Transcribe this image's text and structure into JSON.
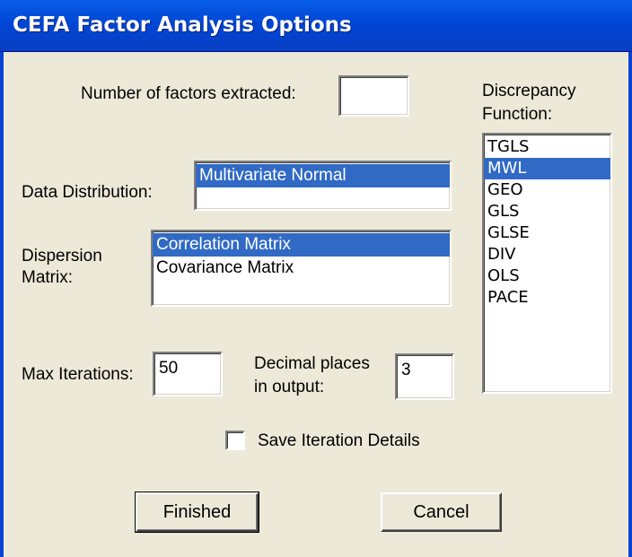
{
  "window": {
    "title": "CEFA Factor Analysis Options"
  },
  "factors": {
    "label": "Number of factors extracted:",
    "value": ""
  },
  "discrepancy": {
    "label_line1": "Discrepancy",
    "label_line2": "Function:",
    "items": [
      "TGLS",
      "MWL",
      "GEO",
      "GLS",
      "GLSE",
      "DIV",
      "OLS",
      "PACE"
    ],
    "selected": "MWL"
  },
  "data_distribution": {
    "label": "Data Distribution:",
    "items": [
      "Multivariate Normal"
    ],
    "selected": "Multivariate Normal"
  },
  "dispersion": {
    "label_line1": "Dispersion",
    "label_line2": "Matrix:",
    "items": [
      "Correlation Matrix",
      "Covariance Matrix"
    ],
    "selected": "Correlation Matrix"
  },
  "max_iterations": {
    "label": "Max Iterations:",
    "value": "50"
  },
  "decimal_places": {
    "label_line1": "Decimal places",
    "label_line2": "in output:",
    "value": "3"
  },
  "save_iterations": {
    "label": "Save Iteration Details",
    "checked": false
  },
  "buttons": {
    "finished": "Finished",
    "cancel": "Cancel"
  },
  "colors": {
    "title_bar": "#0054e3",
    "selection": "#316ac5",
    "dialog_bg": "#ece9d8"
  }
}
